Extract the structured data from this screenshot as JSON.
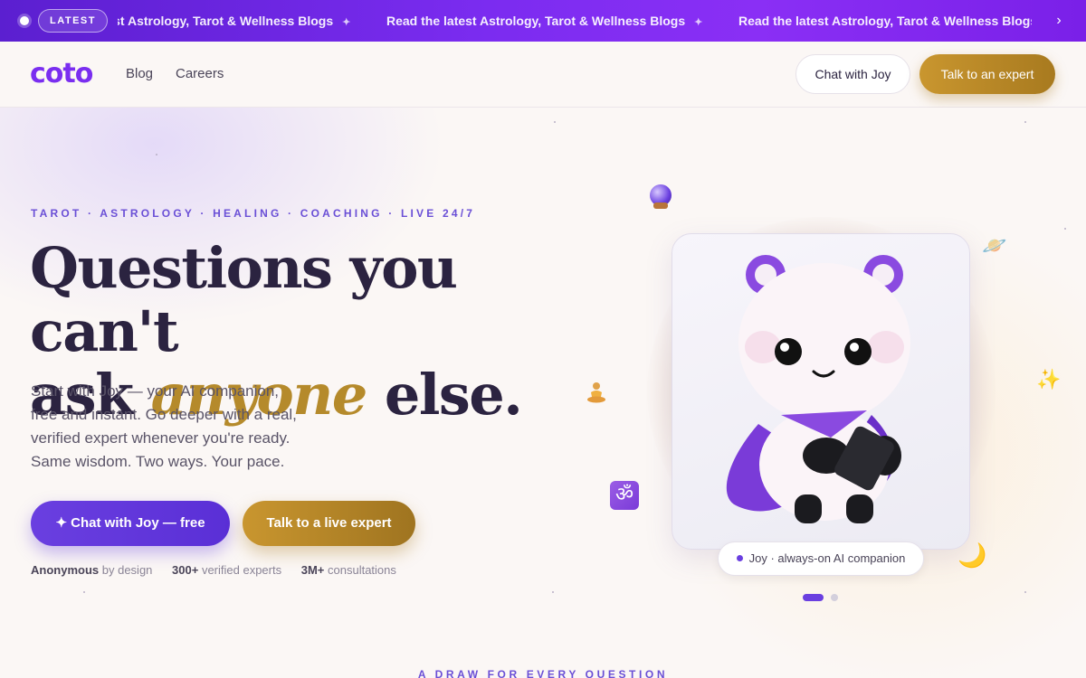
{
  "ticker": {
    "badge": "LATEST",
    "items": [
      "Read the latest Astrology, Tarot & Wellness Blogs",
      "Read the latest Astrology, Tarot & Wellness Blogs",
      "Read the latest Astrology, Tarot & Wellness Blogs"
    ],
    "separator": "✦",
    "next_icon": "›"
  },
  "header": {
    "logo": "coto",
    "nav": [
      "Blog",
      "Careers"
    ],
    "chat_button": "Chat with Joy",
    "expert_button": "Talk to an expert"
  },
  "hero": {
    "eyebrow": "TAROT · ASTROLOGY · HEALING · COACHING · LIVE 24/7",
    "headline_line1": "Questions you can't",
    "headline_ask": "ask",
    "headline_accent": "anyone",
    "headline_end": "else.",
    "subtitle": "Start with Joy — your AI companion, free and instant. Go deeper with a real, verified expert whenever you're ready. Same wisdom. Two ways. Your pace.",
    "cta_primary": "✦ Chat with Joy — free",
    "cta_secondary": "Talk to a live expert",
    "stats": [
      {
        "bold": "Anonymous",
        "text": "by design"
      },
      {
        "bold": "300+",
        "text": "verified experts"
      },
      {
        "bold": "3M+",
        "text": "consultations"
      }
    ]
  },
  "visual": {
    "caption": "Joy · always-on AI companion",
    "icons": [
      "crystal-ball-icon",
      "planet-icon",
      "sparkles-icon",
      "moon-icon",
      "om-icon",
      "meditation-icon"
    ],
    "om_glyph": "ॐ",
    "planet_glyph": "🪐",
    "sparkle_glyph": "✨",
    "moon_glyph": "🌙"
  },
  "section": {
    "label": "A DRAW FOR EVERY QUESTION"
  },
  "colors": {
    "brand_purple": "#7a2ef0",
    "accent_gold": "#b58a2b",
    "primary_button": "#6a3fe0"
  }
}
